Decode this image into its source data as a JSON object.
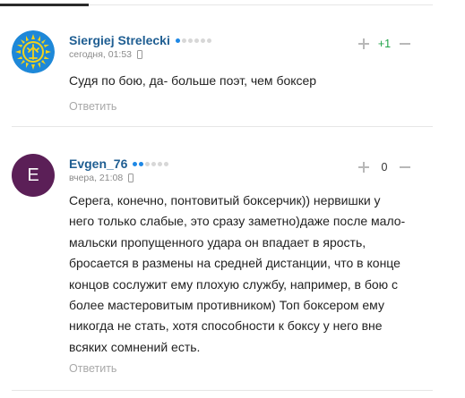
{
  "comments": [
    {
      "author": "Siergiej Strelecki",
      "rating_level": 1,
      "rating_total": 6,
      "time": "сегодня, 01:53",
      "score": "+1",
      "text": "Судя по бою, да- больше поэт, чем боксер",
      "reply_label": "Ответить",
      "avatar_colors": {
        "background": "#1e88d8",
        "emblem": "#f2d21b"
      }
    },
    {
      "author": "Evgen_76",
      "rating_level": 2,
      "rating_total": 6,
      "time": "вчера, 21:08",
      "score": "0",
      "avatar_letter": "E",
      "avatar_color": "#5b1f57",
      "text_lines": [
        "Серега, конечно, понтовитый боксерчик)) нервишки у",
        "него только слабые, это сразу заметно)даже после мало-",
        "мальски пропущенного удара он впадает в ярость,",
        "бросается в размены на средней дистанции, что в конце",
        "концов сослужит ему плохую службу, например, в бою с",
        "более мастеровитым противником) Топ боксером ему",
        "никогда не стать, хотя способности к боксу у него вне",
        "всяких сомнений есть."
      ],
      "reply_label": "Ответить"
    }
  ],
  "colors": {
    "author_link": "#1f5e92",
    "positive_score": "#22a34a",
    "rating_dot_on": "#1e88e5",
    "rating_dot_off": "#d7d7d7",
    "reply_text": "#a9a9a9"
  }
}
